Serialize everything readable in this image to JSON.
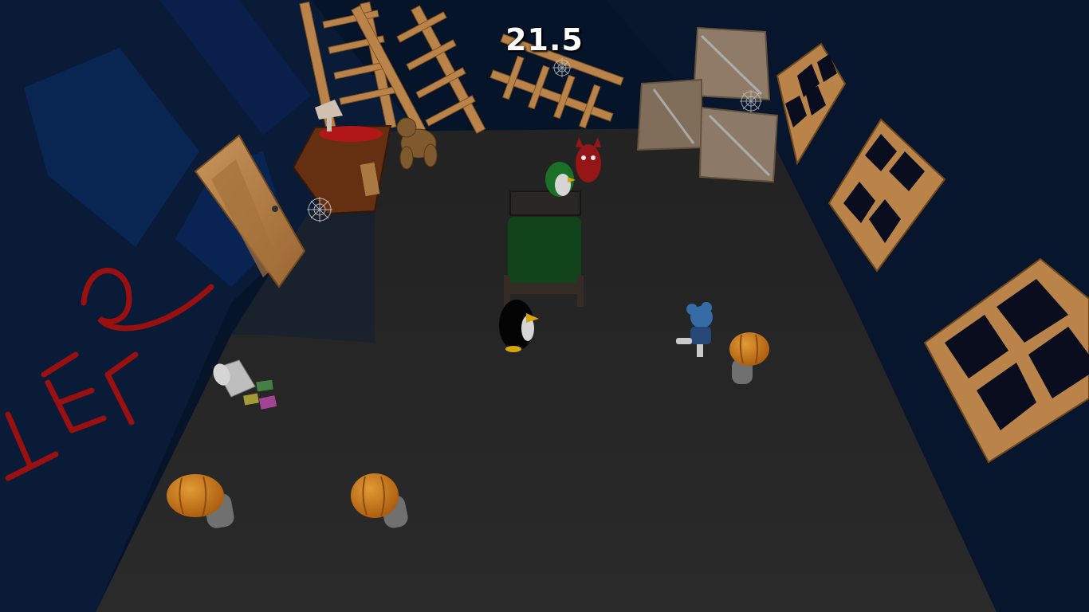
{
  "hud": {
    "timer": "21.5"
  },
  "scene": {
    "wall_graffiti": "TELE",
    "objects": [
      {
        "name": "ladder-left",
        "icon": "ladder-icon"
      },
      {
        "name": "ladder-middle",
        "icon": "ladder-icon"
      },
      {
        "name": "crib-rail",
        "icon": "ladder-icon"
      },
      {
        "name": "stacked-crates",
        "icon": "crate-icon"
      },
      {
        "name": "door",
        "icon": "door-icon"
      },
      {
        "name": "dresser",
        "icon": "dresser-icon"
      },
      {
        "name": "lamp",
        "icon": "lamp-icon"
      },
      {
        "name": "teddy-bear",
        "icon": "teddy-icon"
      },
      {
        "name": "bed",
        "icon": "bed-icon"
      },
      {
        "name": "windows",
        "icon": "window-icon"
      },
      {
        "name": "pumpkin-mushrooms",
        "icon": "pumpkin-icon"
      },
      {
        "name": "spilled-cup-and-blocks",
        "icon": "toy-blocks-icon"
      }
    ],
    "characters": [
      {
        "name": "player-penguin",
        "icon": "penguin-icon"
      },
      {
        "name": "green-penguin",
        "icon": "penguin-icon"
      },
      {
        "name": "red-devil",
        "icon": "devil-icon"
      },
      {
        "name": "blue-haired-girl",
        "icon": "girl-icon"
      }
    ]
  },
  "colors": {
    "floor": "#2a2a2a",
    "wall": "#0c1f3d",
    "wood": "#c28a4e",
    "graffiti": "#b01515",
    "bed_cover": "#134a1e",
    "pumpkin": "#e18a1a"
  }
}
